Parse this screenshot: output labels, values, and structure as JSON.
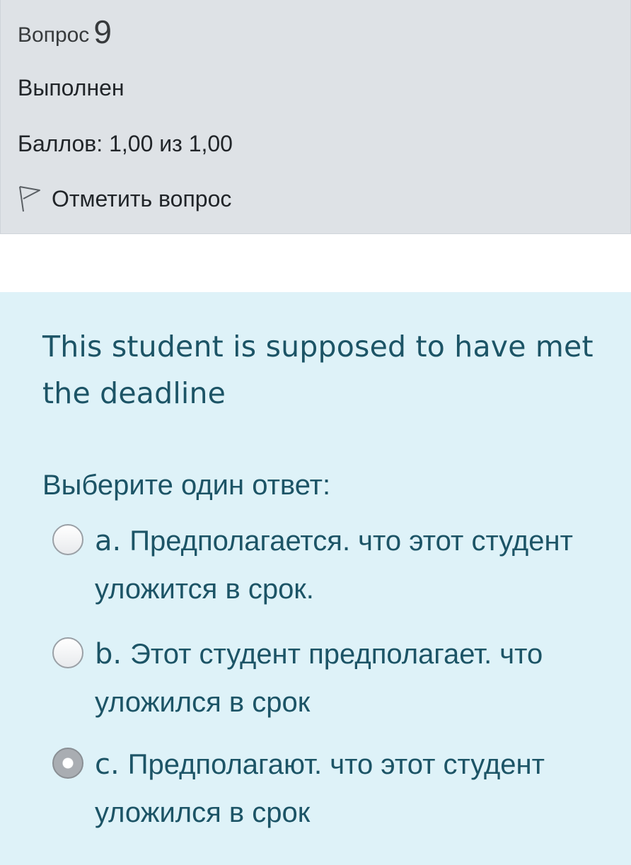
{
  "info": {
    "question_label": "Вопрос",
    "question_number": "9",
    "state": "Выполнен",
    "grade": "Баллов: 1,00 из 1,00",
    "flag_label": "Отметить вопрос"
  },
  "question": {
    "text": "This student is supposed to have met the deadline",
    "prompt": "Выберите один ответ:",
    "answers": [
      {
        "letter": "a.",
        "text": "Предполагается. что этот студент уложится в срок.",
        "selected": false
      },
      {
        "letter": "b.",
        "text": "Этот студент предполагает. что уложился в срок",
        "selected": false
      },
      {
        "letter": "c.",
        "text": "Предполагают. что этот студент уложился в срок",
        "selected": true
      }
    ]
  },
  "colors": {
    "info_background": "#dee2e6",
    "formulation_background": "#def2f8",
    "question_text": "#1c5466"
  },
  "icons": {
    "flag": "flag-outline-icon",
    "radio_unchecked": "radio-unchecked-icon",
    "radio_checked": "radio-checked-icon"
  }
}
